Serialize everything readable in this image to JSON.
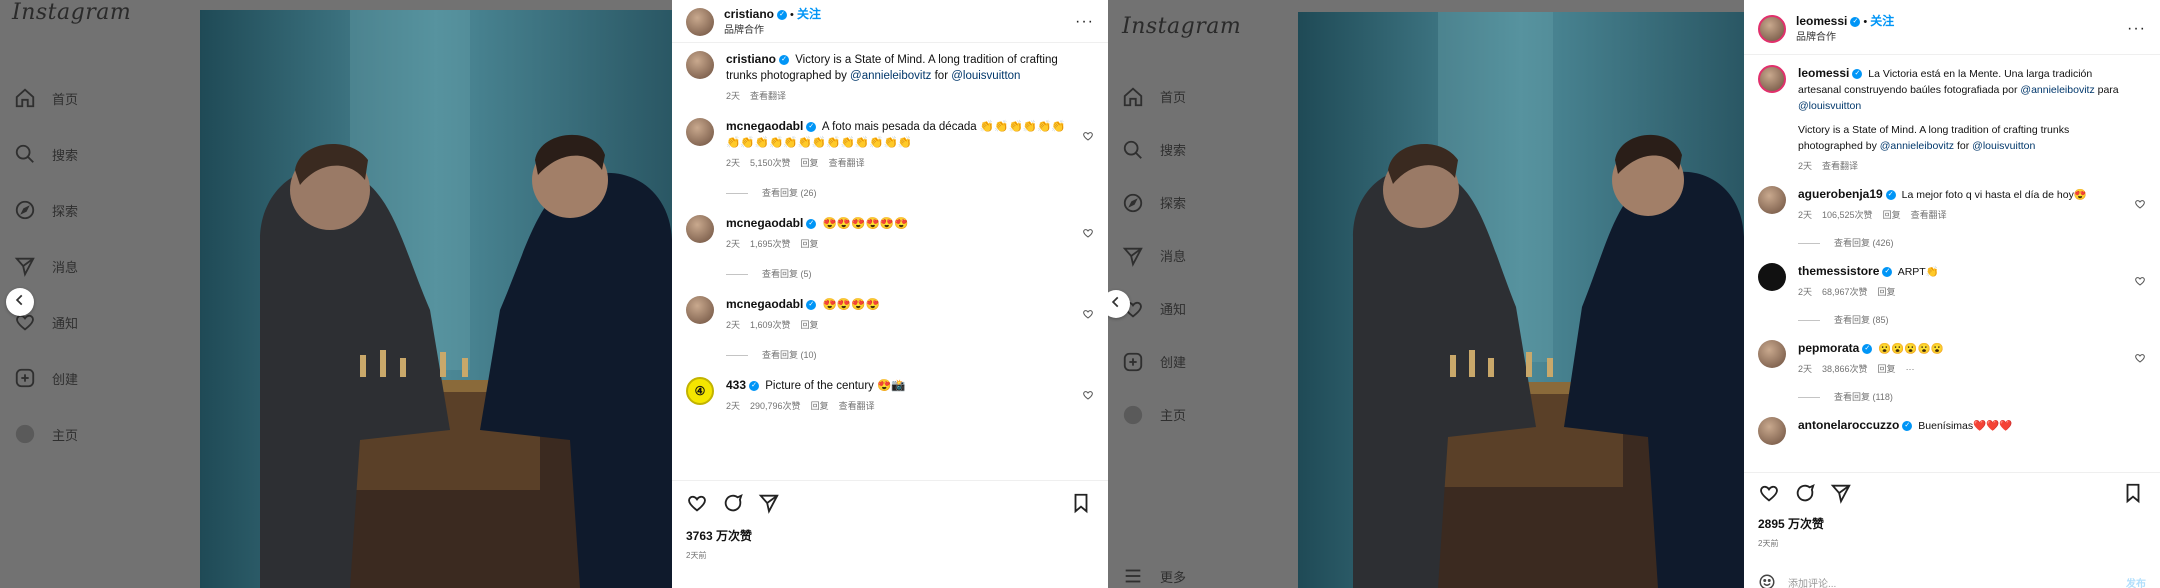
{
  "left": {
    "logo": "Instagram",
    "nav": [
      {
        "label": "首页",
        "icon": "home-icon"
      },
      {
        "label": "搜索",
        "icon": "search-icon"
      },
      {
        "label": "探索",
        "icon": "compass-icon"
      },
      {
        "label": "消息",
        "icon": "send-icon"
      },
      {
        "label": "通知",
        "icon": "heart-icon"
      },
      {
        "label": "创建",
        "icon": "create-icon"
      },
      {
        "label": "主页",
        "icon": "profile-icon"
      }
    ],
    "post": {
      "username": "cristiano",
      "follow": "关注",
      "subtitle": "品牌合作",
      "caption_user": "cristiano",
      "caption_text": "Victory is a State of Mind. A long tradition of crafting trunks photographed by",
      "caption_link1": "@annieleibovitz",
      "caption_for": "for",
      "caption_link2": "@louisvuitton",
      "caption_time": "2天",
      "caption_translate": "查看翻译",
      "comments": [
        {
          "user": "mcnegaodabl",
          "text": "A foto mais pesada da década 👏👏👏👏👏👏👏👏👏👏👏👏👏👏👏👏👏👏👏",
          "time": "2天",
          "likes": "5,150次赞",
          "reply": "回复",
          "translate": "查看翻译",
          "replies": "查看回复 (26)"
        },
        {
          "user": "mcnegaodabl",
          "text": "😍😍😍😍😍😍",
          "time": "2天",
          "likes": "1,695次赞",
          "reply": "回复",
          "translate": "",
          "replies": "查看回复 (5)"
        },
        {
          "user": "mcnegaodabl",
          "text": "😍😍😍😍",
          "time": "2天",
          "likes": "1,609次赞",
          "reply": "回复",
          "translate": "",
          "replies": "查看回复 (10)"
        },
        {
          "user": "433",
          "text": "Picture of the century 😍📸",
          "time": "2天",
          "likes": "290,796次赞",
          "reply": "回复",
          "translate": "查看翻译",
          "replies": ""
        }
      ],
      "likes": "3763 万次赞",
      "date": "2天前"
    }
  },
  "right": {
    "logo": "Instagram",
    "nav": [
      {
        "label": "首页",
        "icon": "home-icon"
      },
      {
        "label": "搜索",
        "icon": "search-icon"
      },
      {
        "label": "探索",
        "icon": "compass-icon"
      },
      {
        "label": "消息",
        "icon": "send-icon"
      },
      {
        "label": "通知",
        "icon": "heart-icon"
      },
      {
        "label": "创建",
        "icon": "create-icon"
      },
      {
        "label": "主页",
        "icon": "profile-icon"
      }
    ],
    "more": "更多",
    "post": {
      "username": "leomessi",
      "follow": "关注",
      "subtitle": "品牌合作",
      "caption_user": "leomessi",
      "caption_text_es": "La Victoria está en la Mente. Una larga tradición artesanal construyendo baúles fotografiada por",
      "caption_link_es1": "@annieleibovitz",
      "caption_para": "para",
      "caption_link_es2": "@louisvuitton",
      "caption_text_en": "Victory is a State of Mind. A long tradition of crafting trunks photographed by",
      "caption_link_en1": "@annieleibovitz",
      "caption_for": "for",
      "caption_link_en2": "@louisvuitton",
      "caption_time": "2天",
      "caption_translate": "查看翻译",
      "comments": [
        {
          "user": "aguerobenja19",
          "text": "La mejor foto q vi hasta el día de hoy😍",
          "time": "2天",
          "likes": "106,525次赞",
          "reply": "回复",
          "translate": "查看翻译",
          "replies": "查看回复 (426)"
        },
        {
          "user": "themessistore",
          "text": "ARPT👏",
          "time": "2天",
          "likes": "68,967次赞",
          "reply": "回复",
          "translate": "",
          "replies": "查看回复 (85)"
        },
        {
          "user": "pepmorata",
          "text": "😮😮😮😮😮",
          "time": "2天",
          "likes": "38,866次赞",
          "reply": "回复",
          "translate": "···",
          "replies": "查看回复 (118)"
        },
        {
          "user": "antonelaroccuzzo",
          "text": "Buenísimas❤️❤️❤️",
          "time": "",
          "likes": "",
          "reply": "",
          "translate": "",
          "replies": ""
        }
      ],
      "likes": "2895 万次赞",
      "date": "2天前",
      "add_comment_placeholder": "添加评论...",
      "post_button": "发布"
    }
  },
  "colors": {
    "accent": "#0095f6",
    "link": "#00376b",
    "overlay": "#727272"
  }
}
